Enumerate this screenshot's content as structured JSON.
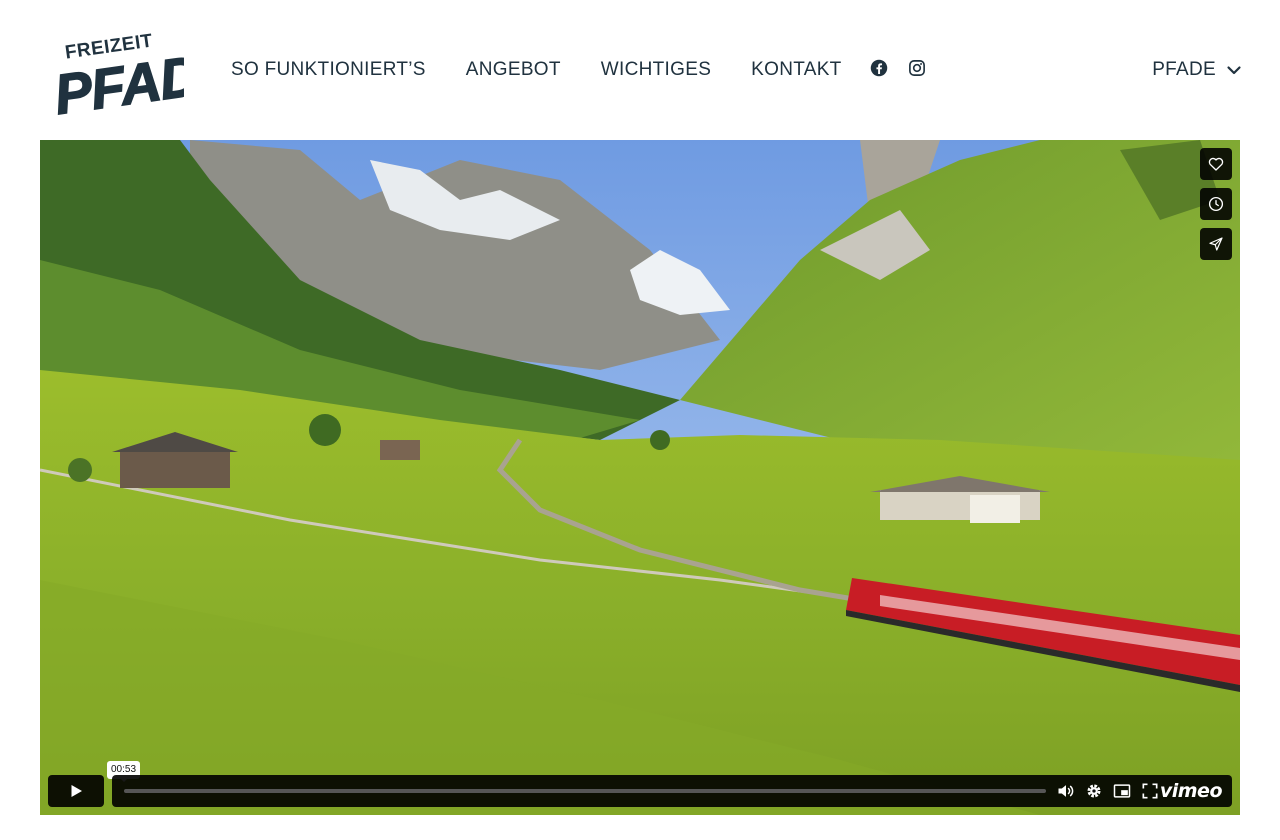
{
  "brand": {
    "name": "FREIZEIT PFAD",
    "logo_top": "FREIZEIT",
    "logo_main": "PFAD",
    "color": "#20323f"
  },
  "nav": {
    "items": [
      {
        "label": "SO FUNKTIONIERT’S"
      },
      {
        "label": "ANGEBOT"
      },
      {
        "label": "WICHTIGES"
      },
      {
        "label": "KONTAKT"
      }
    ]
  },
  "social": {
    "icons": [
      "facebook-icon",
      "instagram-icon"
    ]
  },
  "language_menu": {
    "label": "PFADE",
    "icon": "chevron-down-icon"
  },
  "video": {
    "side_actions": [
      "heart-icon",
      "clock-icon",
      "send-icon"
    ],
    "play_icon": "play-icon",
    "tooltip_time": "00:53",
    "progress": 0.0,
    "control_icons": [
      "volume-icon",
      "settings-icon",
      "picture-in-picture-icon",
      "fullscreen-icon"
    ],
    "provider_logo": "vimeo"
  }
}
